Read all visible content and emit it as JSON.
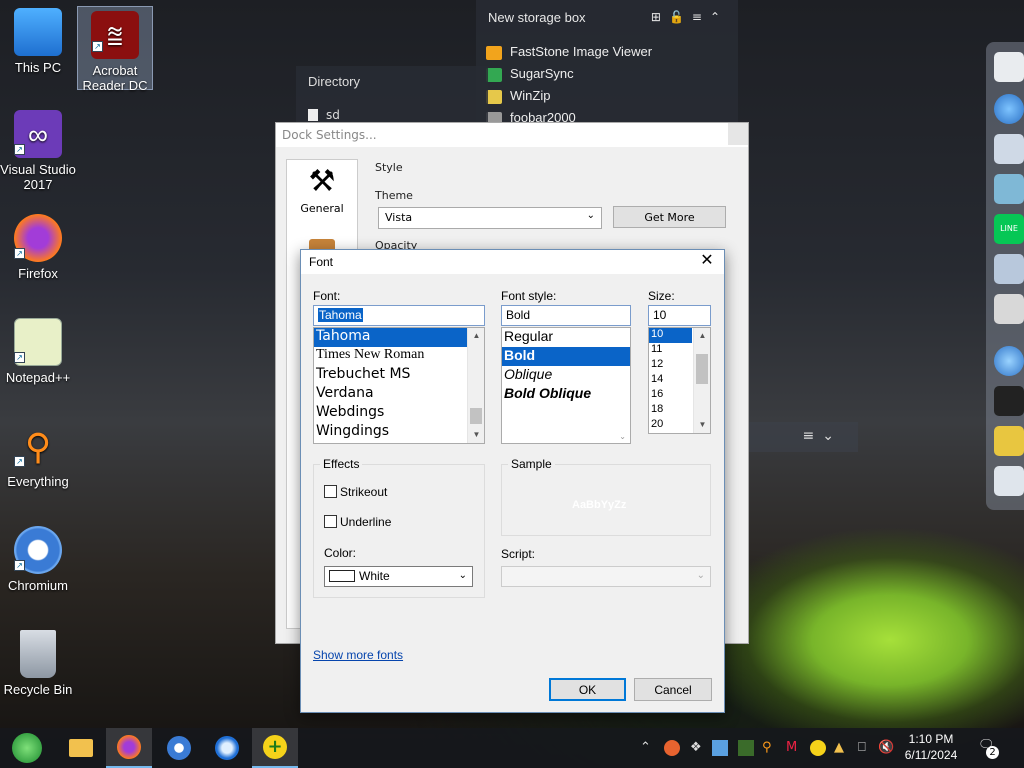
{
  "desktop": {
    "icons": [
      {
        "label_1": "This PC",
        "label_2": ""
      },
      {
        "label_1": "Acrobat",
        "label_2": "Reader DC"
      },
      {
        "label_1": "Visual Studio",
        "label_2": "2017"
      },
      {
        "label_1": "Firefox",
        "label_2": ""
      },
      {
        "label_1": "Notepad++",
        "label_2": ""
      },
      {
        "label_1": "Everything",
        "label_2": ""
      },
      {
        "label_1": "Chromium",
        "label_2": ""
      },
      {
        "label_1": "Recycle Bin",
        "label_2": ""
      }
    ]
  },
  "storage_box": {
    "title": "New storage box",
    "items": [
      "FastStone Image Viewer",
      "SugarSync",
      "WinZip",
      "foobar2000"
    ]
  },
  "directory": {
    "title": "Directory",
    "item": "sd"
  },
  "dock_settings": {
    "title": "Dock Settings...",
    "nav_general": "General",
    "style_label": "Style",
    "theme_label": "Theme",
    "theme_value": "Vista",
    "get_more_label": "Get More",
    "opacity_label": "Opacity"
  },
  "font_dialog": {
    "title": "Font",
    "font_label": "Font:",
    "font_value": "Tahoma",
    "font_list": [
      "Tahoma",
      "Times New Roman",
      "Trebuchet MS",
      "Verdana",
      "Webdings",
      "Wingdings"
    ],
    "style_label": "Font style:",
    "style_value": "Bold",
    "style_list": [
      "Regular",
      "Bold",
      "Oblique",
      "Bold Oblique"
    ],
    "size_label": "Size:",
    "size_value": "10",
    "size_list": [
      "10",
      "11",
      "12",
      "14",
      "16",
      "18",
      "20"
    ],
    "effects_label": "Effects",
    "strikeout_label": "Strikeout",
    "underline_label": "Underline",
    "color_label": "Color:",
    "color_value": "White",
    "sample_label": "Sample",
    "sample_text": "AaBbYyZz",
    "script_label": "Script:",
    "show_more_fonts": "Show more fonts",
    "ok_label": "OK",
    "cancel_label": "Cancel"
  },
  "taskbar": {
    "time": "1:10 PM",
    "date": "6/11/2024",
    "notification_count": "2"
  },
  "colors": {
    "selection": "#0a64c8",
    "link": "#0645ad",
    "default_button_border": "#0078d7"
  }
}
